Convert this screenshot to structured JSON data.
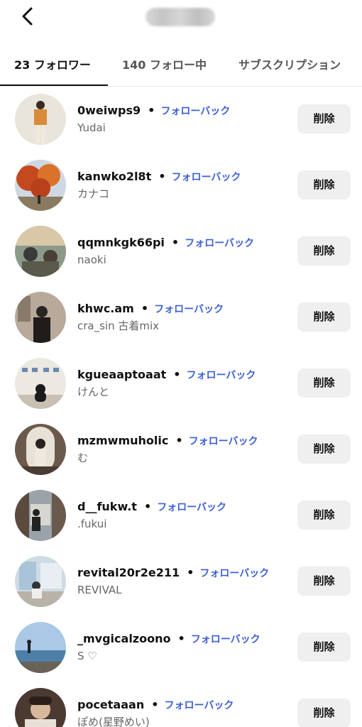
{
  "tabs": [
    {
      "label": "23 フォロワー",
      "active": true
    },
    {
      "label": "140 フォロー中",
      "active": false
    },
    {
      "label": "サブスクリプション",
      "active": false
    }
  ],
  "followers": [
    {
      "username": "0weiwps9",
      "subname": "Yudai",
      "followback": "フォローバック",
      "remove": "削除"
    },
    {
      "username": "kanwko2l8t",
      "subname": "カナコ",
      "followback": "フォローバック",
      "remove": "削除"
    },
    {
      "username": "qqmnkgk66pi",
      "subname": "naoki",
      "followback": "フォローバック",
      "remove": "削除"
    },
    {
      "username": "khwc.am",
      "subname": "cra_sin 古着mix",
      "followback": "フォローバック",
      "remove": "削除"
    },
    {
      "username": "kgueaaptoaat",
      "subname": "けんと",
      "followback": "フォローバック",
      "remove": "削除"
    },
    {
      "username": "mzmwmuholic",
      "subname": "む",
      "followback": "フォローバック",
      "remove": "削除"
    },
    {
      "username": "d__fukw.t",
      "subname": ".fukui",
      "followback": "フォローバック",
      "remove": "削除"
    },
    {
      "username": "revital20r2e211",
      "subname": "REVIVAL",
      "followback": "フォローバック",
      "remove": "削除"
    },
    {
      "username": "_mvgicalzoono",
      "subname": "S ♡",
      "followback": "フォローバック",
      "remove": "削除"
    },
    {
      "username": "pocetaaan",
      "subname": "ぽめ(星野めい)",
      "followback": "フォローバック",
      "remove": "削除"
    }
  ],
  "colors": {
    "link": "#3b5fd6",
    "button_bg": "#efefef"
  },
  "icons": {
    "back": "chevron-left-icon"
  }
}
